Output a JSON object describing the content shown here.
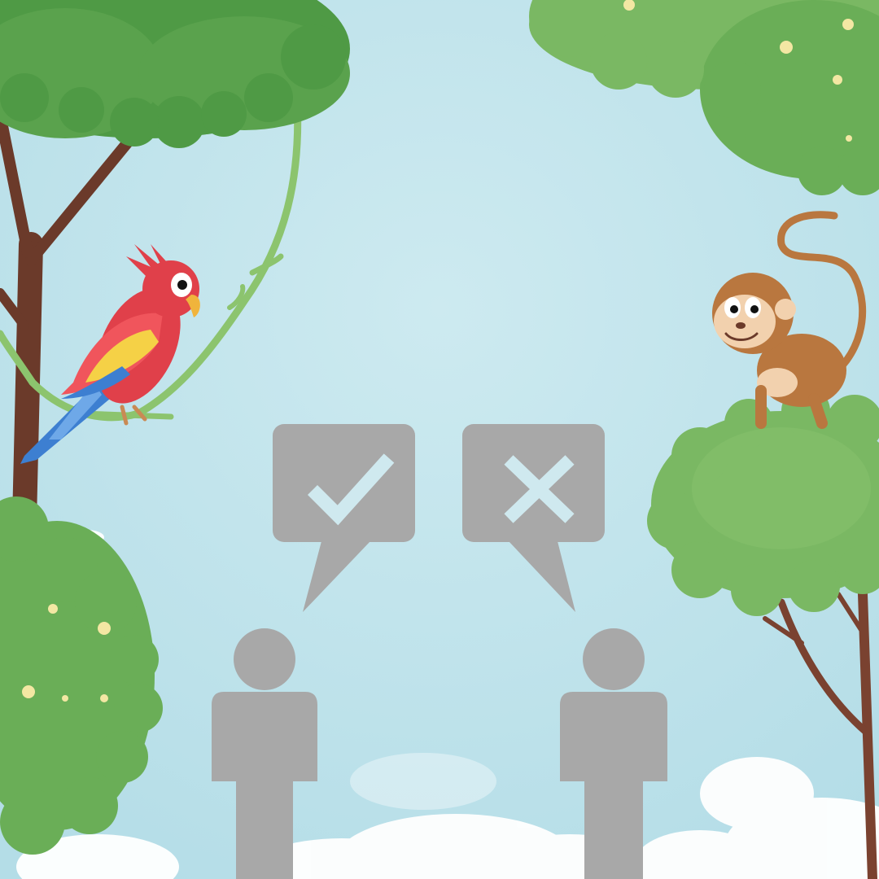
{
  "scene": {
    "elements": [
      "parrot",
      "monkey",
      "person-left",
      "person-right",
      "speech-bubble-check",
      "speech-bubble-cross",
      "trees",
      "vine",
      "clouds"
    ],
    "icons": {
      "agree": "check-icon",
      "disagree": "cross-icon"
    },
    "colors": {
      "sky": "#bfe4ec",
      "sky_light": "#d6eef3",
      "cloud": "#ffffff",
      "leaf_dark": "#4f9a45",
      "leaf_mid": "#6aae57",
      "leaf_light": "#8cc46e",
      "trunk": "#6b3a2a",
      "vine": "#8cc46e",
      "figure": "#a8a8a8",
      "icon_mark": "#cfe9ef",
      "fruit": "#f3e7a3",
      "parrot_red": "#e0404a",
      "parrot_yellow": "#f5d146",
      "parrot_blue": "#3d7fd1",
      "monkey_brown": "#b9773f",
      "monkey_face": "#f2d1ae"
    }
  }
}
